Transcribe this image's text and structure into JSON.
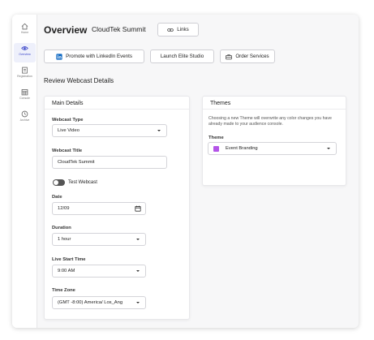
{
  "sidebar": {
    "items": [
      {
        "icon": "home-icon",
        "label": "Home"
      },
      {
        "icon": "eye-icon",
        "label": "Overview",
        "active": true
      },
      {
        "icon": "clipboard-icon",
        "label": "Registration"
      },
      {
        "icon": "calendar-icon",
        "label": "Console"
      },
      {
        "icon": "history-icon",
        "label": "Archive"
      }
    ]
  },
  "header": {
    "title": "Overview",
    "event_name": "CloudTek Summit",
    "links_button": "Links"
  },
  "actions": {
    "linkedin": "Promote with LinkedIn Events",
    "studio": "Launch Elite Studio",
    "order": "Order Services"
  },
  "section_title": "Review Webcast Details",
  "main_details": {
    "heading": "Main Details",
    "webcast_type_label": "Webcast Type",
    "webcast_type_value": "Live Video",
    "webcast_title_label": "Webcast Title",
    "webcast_title_value": "CloudTek Summit",
    "test_webcast_label": "Test Webcast",
    "date_label": "Date",
    "date_value": "12/09",
    "duration_label": "Duration",
    "duration_value": "1 hour",
    "start_time_label": "Live Start Time",
    "start_time_value": "9:00 AM",
    "time_zone_label": "Time Zone",
    "time_zone_value": "(GMT -8:00) America/ Los_Ang"
  },
  "themes": {
    "heading": "Themes",
    "description": "Choosing a new Theme will overwrite any color changes you have already made to your audience console.",
    "theme_label": "Theme",
    "theme_value": "Event Branding",
    "theme_color": "#b455e8"
  },
  "colors": {
    "accent": "#3b46c9",
    "linkedin": "#0a66c2"
  }
}
